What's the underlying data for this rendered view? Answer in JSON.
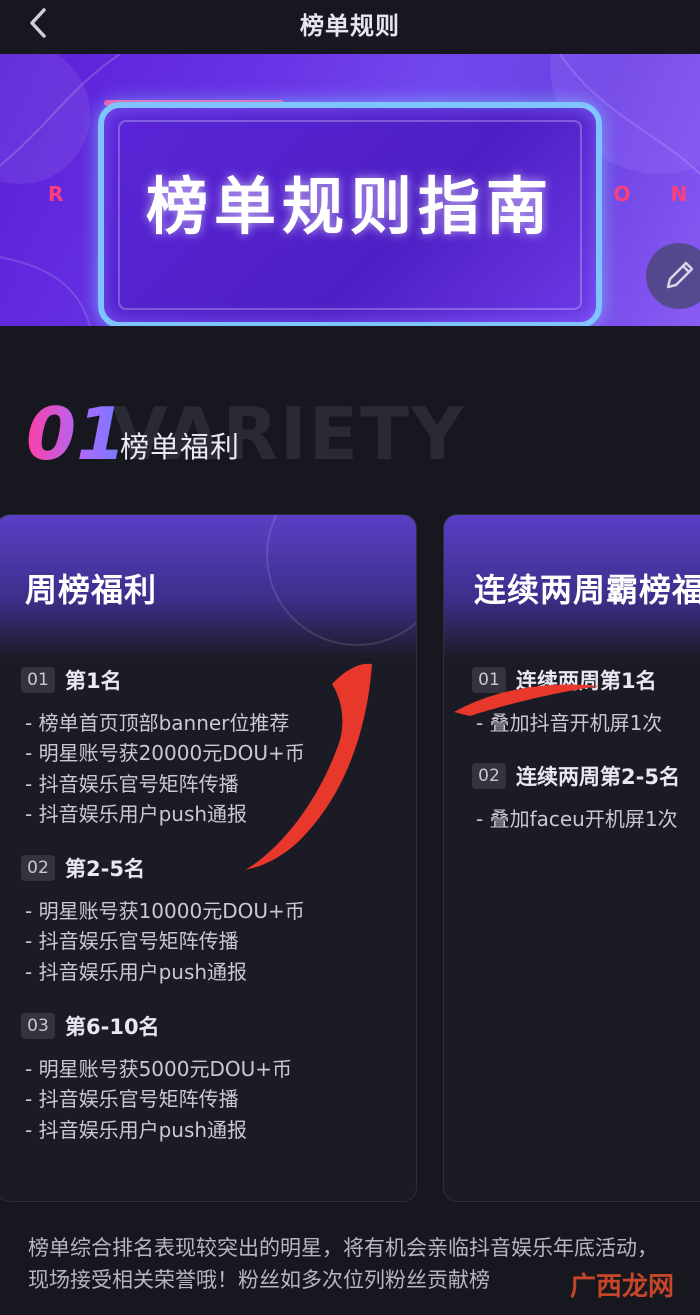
{
  "header": {
    "title": "榜单规则"
  },
  "banner": {
    "title": "榜单规则指南",
    "deco_left": "RUL",
    "deco_right": "ION"
  },
  "section": {
    "number": "01",
    "bg_text": "VARIETY",
    "title": "榜单福利"
  },
  "cards": [
    {
      "title": "周榜福利",
      "groups": [
        {
          "rank": "01",
          "label": "第1名",
          "items": [
            "- 榜单首页顶部banner位推荐",
            "- 明星账号获20000元DOU+币",
            "- 抖音娱乐官号矩阵传播",
            "- 抖音娱乐用户push通报"
          ]
        },
        {
          "rank": "02",
          "label": "第2-5名",
          "items": [
            "- 明星账号获10000元DOU+币",
            "- 抖音娱乐官号矩阵传播",
            "- 抖音娱乐用户push通报"
          ]
        },
        {
          "rank": "03",
          "label": "第6-10名",
          "items": [
            "- 明星账号获5000元DOU+币",
            "- 抖音娱乐官号矩阵传播",
            "- 抖音娱乐用户push通报"
          ]
        }
      ]
    },
    {
      "title": "连续两周霸榜福",
      "groups": [
        {
          "rank": "01",
          "label": "连续两周第1名",
          "items": [
            "- 叠加抖音开机屏1次"
          ]
        },
        {
          "rank": "02",
          "label": "连续两周第2-5名",
          "items": [
            "- 叠加faceu开机屏1次"
          ]
        }
      ]
    }
  ],
  "footer": {
    "text": "榜单综合排名表现较突出的明星，将有机会亲临抖音娱乐年底活动，现场接受相关荣誉哦！粉丝如多次位列粉丝贡献榜"
  },
  "watermark": "广西龙网",
  "colors": {
    "background": "#17171f",
    "accent": "#6a34e6",
    "annotation": "#e8382c"
  }
}
